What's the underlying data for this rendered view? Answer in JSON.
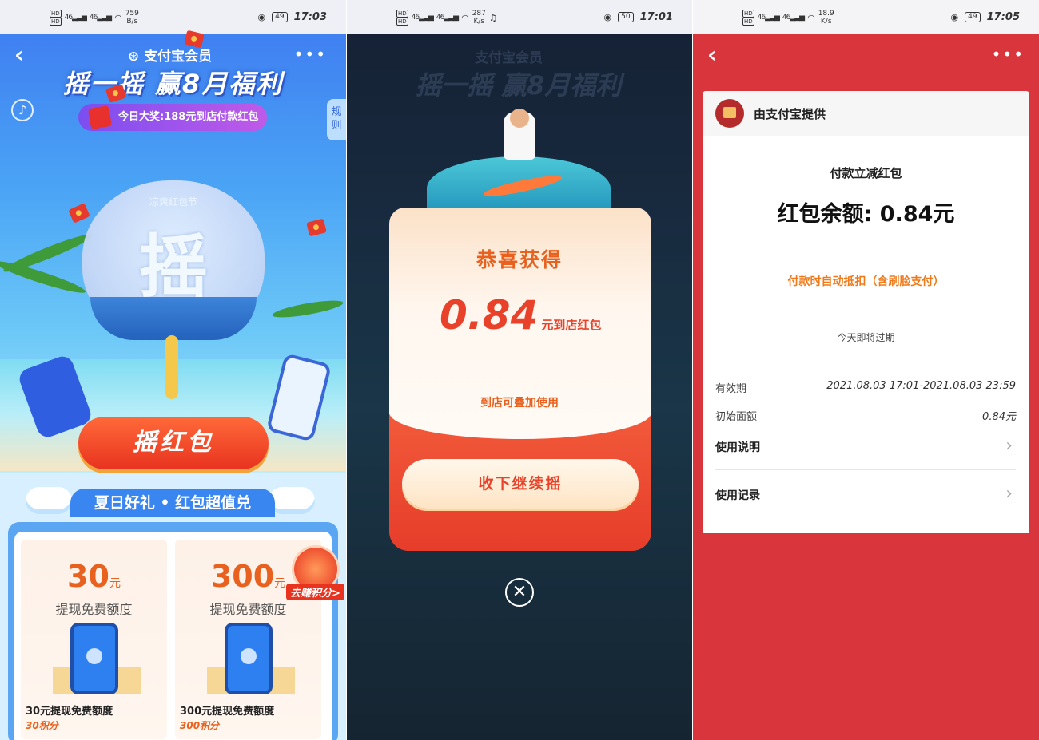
{
  "panel1": {
    "status": {
      "speed": "759",
      "speed_unit": "B/s",
      "battery": "49",
      "time": "17:03",
      "signal": "46"
    },
    "brand": "支付宝会员",
    "headline": "摇一摇 赢8月福利",
    "prize_pill": "今日大奖:188元到店付款红包",
    "rules_tab": "规则",
    "fan_subtitle": "凉爽红包节",
    "fan_char": "摇",
    "shake_button": "摇红包",
    "summer_title": "夏日好礼 • 红包超值兑",
    "earn_points": "去赚积分>",
    "cards": [
      {
        "amount": "30",
        "unit": "元",
        "desc": "提现免费额度",
        "caption": "30元提现免费额度",
        "points": "30积分"
      },
      {
        "amount": "300",
        "unit": "元",
        "desc": "提现免费额度",
        "caption": "300元提现免费额度",
        "points": "300积分"
      }
    ]
  },
  "panel2": {
    "status": {
      "speed": "287",
      "speed_unit": "K/s",
      "battery": "50",
      "time": "17:01",
      "signal": "46"
    },
    "congrats": "恭喜获得",
    "amount": "0.84",
    "amount_unit": "元到店红包",
    "stack_note": "到店可叠加使用",
    "collect_button": "收下继续摇",
    "close_label": "✕",
    "bg_brand": "支付宝会员",
    "bg_headline": "摇一摇 赢8月福利"
  },
  "panel3": {
    "status": {
      "speed": "18.9",
      "speed_unit": "K/s",
      "battery": "49",
      "time": "17:05",
      "signal": "46"
    },
    "provider": "由支付宝提供",
    "type": "付款立减红包",
    "balance": "红包余额: 0.84元",
    "auto_deduct": "付款时自动抵扣（含刷脸支付）",
    "expire_note": "今天即将过期",
    "validity_label": "有效期",
    "validity_value": "2021.08.03 17:01-2021.08.03 23:59",
    "initial_label": "初始面额",
    "initial_value": "0.84元",
    "usage_instructions": "使用说明",
    "usage_records": "使用记录"
  },
  "icons": {
    "back": "‹",
    "more": "•••",
    "chevron": "›",
    "mute": "♪"
  },
  "colors": {
    "alipay_blue": "#3a86f0",
    "red": "#d9353c",
    "orange": "#e8611f"
  }
}
